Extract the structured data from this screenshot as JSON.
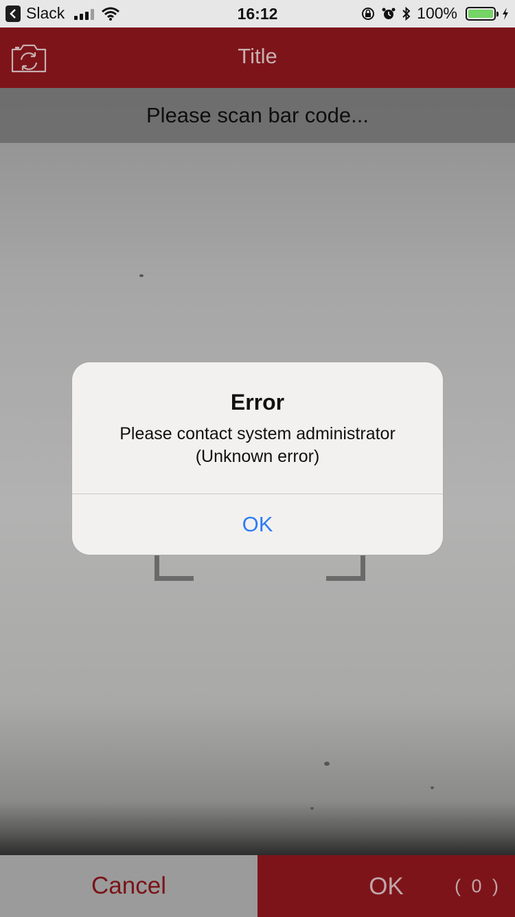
{
  "status_bar": {
    "back_app": "Slack",
    "time": "16:12",
    "battery_percent": "100%",
    "battery_level": 1.0,
    "icons": [
      "back-chevron-icon",
      "signal-icon",
      "wifi-icon",
      "orientation-lock-icon",
      "alarm-icon",
      "bluetooth-icon",
      "battery-icon",
      "charging-icon"
    ]
  },
  "nav": {
    "title": "Title",
    "camera_icon": "camera-switch-icon"
  },
  "scanner": {
    "prompt": "Please scan bar code..."
  },
  "alert": {
    "title": "Error",
    "message": "Please contact system administrator\n(Unknown error)",
    "ok_label": "OK"
  },
  "bottom": {
    "cancel_label": "Cancel",
    "ok_label": "OK",
    "count": "( 0 )"
  },
  "colors": {
    "brand_red": "#7d141a",
    "alert_link_blue": "#2d7cf6",
    "battery_green": "#75d465"
  }
}
